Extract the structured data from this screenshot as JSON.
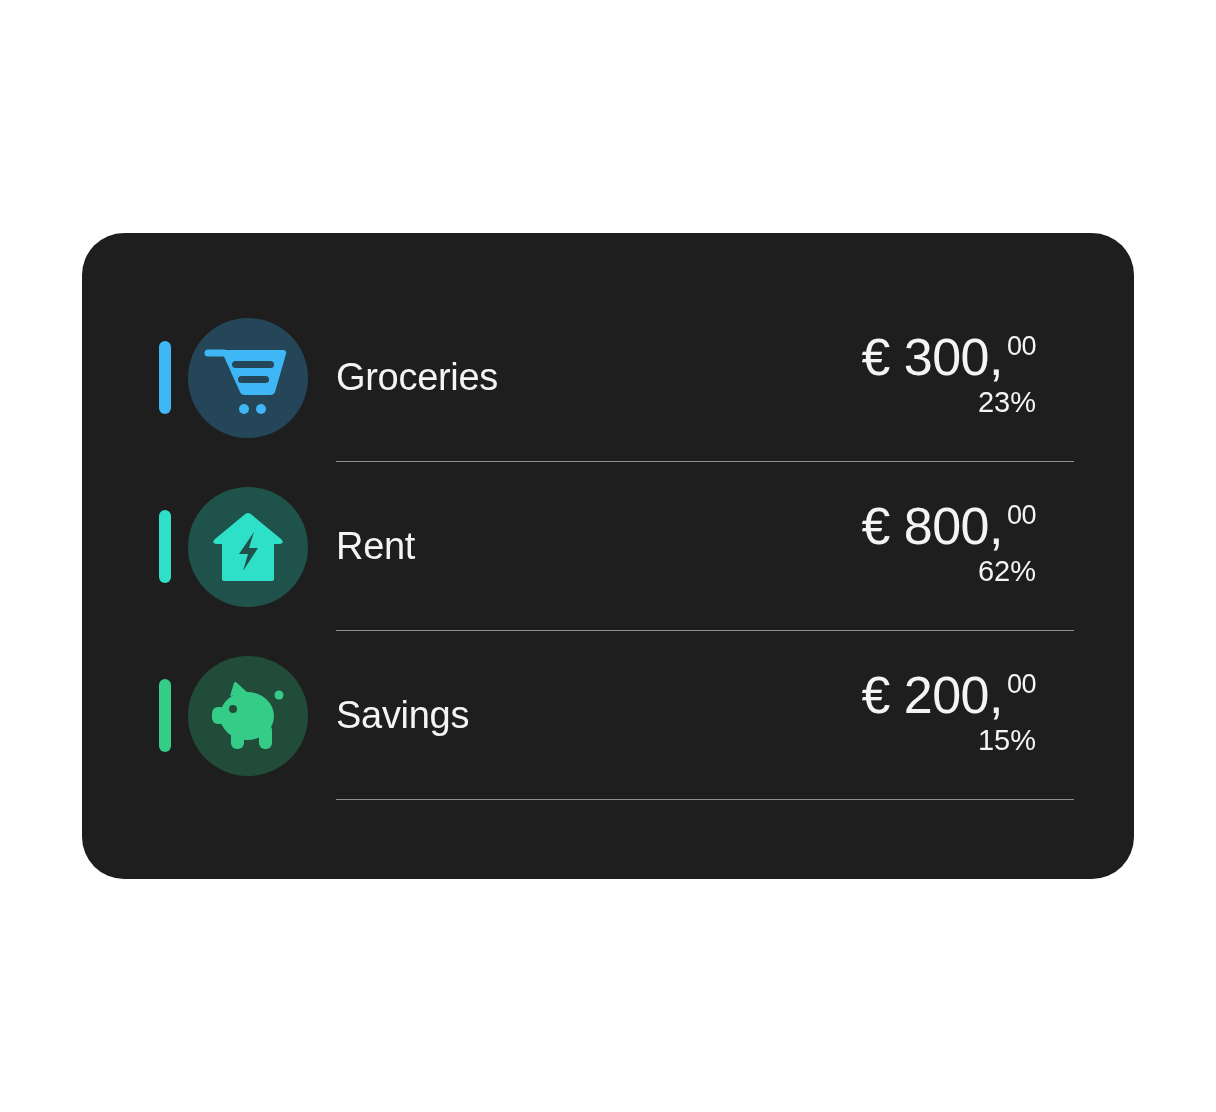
{
  "categories": [
    {
      "name": "Groceries",
      "amount": "€ 300,$^{00}$",
      "share": "23%",
      "color": "#3fb6f5"
    },
    {
      "name": "Rent",
      "amount": "€ 800,$^{00}$",
      "share": "62%",
      "color": "#2ee0c8"
    },
    {
      "name": "Savings",
      "amount": "€ 200,$^{00}$",
      "share": "15%",
      "color": "#35cc88"
    }
  ]
}
